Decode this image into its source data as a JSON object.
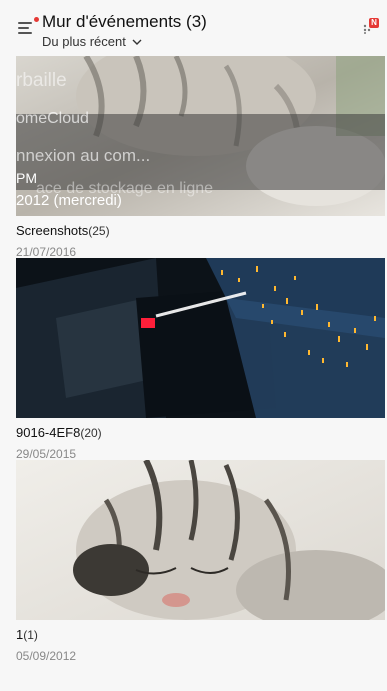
{
  "header": {
    "title": "Mur d'événements (3)",
    "sort_label": "Du plus récent",
    "menu_icon": "menu-icon",
    "sort_icon": "chevron-down-icon",
    "app_icon": "notification-app-icon",
    "badge_text": "N"
  },
  "events": [
    {
      "title": "Screenshots",
      "count": "(25)",
      "date": "21/07/2016",
      "overlay": {
        "line1": "rbaille",
        "line2": "omeCloud",
        "line3": "nnexion au com...",
        "line4": "PM",
        "line5": "ace de stockage en ligne",
        "line6": "2012 (mercredi)"
      }
    },
    {
      "title": "9016-4EF8",
      "count": "(20)",
      "date": "29/05/2015"
    },
    {
      "title": "1",
      "count": "(1)",
      "date": "05/09/2012"
    }
  ],
  "colors": {
    "accent": "#e53935",
    "background": "#f7f7f7"
  }
}
